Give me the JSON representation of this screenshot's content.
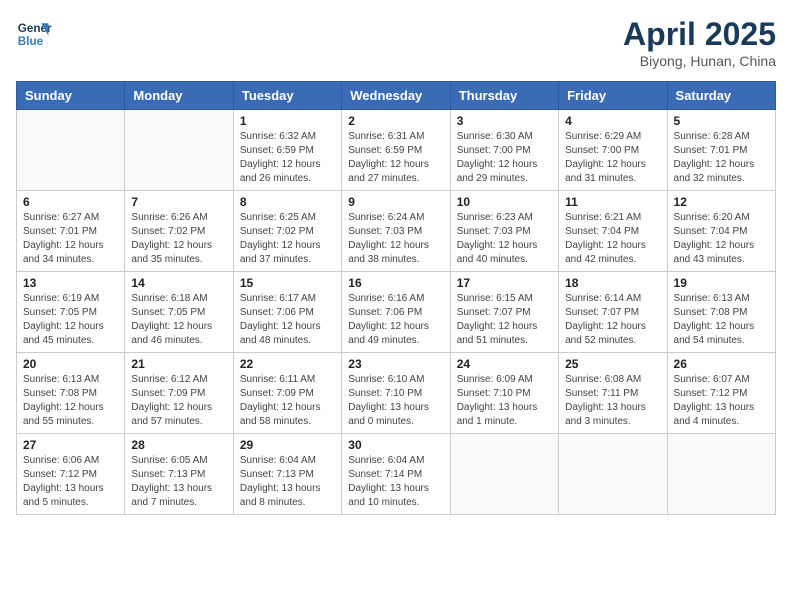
{
  "header": {
    "logo_line1": "General",
    "logo_line2": "Blue",
    "title": "April 2025",
    "location": "Biyong, Hunan, China"
  },
  "weekdays": [
    "Sunday",
    "Monday",
    "Tuesday",
    "Wednesday",
    "Thursday",
    "Friday",
    "Saturday"
  ],
  "weeks": [
    [
      {
        "day": "",
        "info": ""
      },
      {
        "day": "",
        "info": ""
      },
      {
        "day": "1",
        "info": "Sunrise: 6:32 AM\nSunset: 6:59 PM\nDaylight: 12 hours and 26 minutes."
      },
      {
        "day": "2",
        "info": "Sunrise: 6:31 AM\nSunset: 6:59 PM\nDaylight: 12 hours and 27 minutes."
      },
      {
        "day": "3",
        "info": "Sunrise: 6:30 AM\nSunset: 7:00 PM\nDaylight: 12 hours and 29 minutes."
      },
      {
        "day": "4",
        "info": "Sunrise: 6:29 AM\nSunset: 7:00 PM\nDaylight: 12 hours and 31 minutes."
      },
      {
        "day": "5",
        "info": "Sunrise: 6:28 AM\nSunset: 7:01 PM\nDaylight: 12 hours and 32 minutes."
      }
    ],
    [
      {
        "day": "6",
        "info": "Sunrise: 6:27 AM\nSunset: 7:01 PM\nDaylight: 12 hours and 34 minutes."
      },
      {
        "day": "7",
        "info": "Sunrise: 6:26 AM\nSunset: 7:02 PM\nDaylight: 12 hours and 35 minutes."
      },
      {
        "day": "8",
        "info": "Sunrise: 6:25 AM\nSunset: 7:02 PM\nDaylight: 12 hours and 37 minutes."
      },
      {
        "day": "9",
        "info": "Sunrise: 6:24 AM\nSunset: 7:03 PM\nDaylight: 12 hours and 38 minutes."
      },
      {
        "day": "10",
        "info": "Sunrise: 6:23 AM\nSunset: 7:03 PM\nDaylight: 12 hours and 40 minutes."
      },
      {
        "day": "11",
        "info": "Sunrise: 6:21 AM\nSunset: 7:04 PM\nDaylight: 12 hours and 42 minutes."
      },
      {
        "day": "12",
        "info": "Sunrise: 6:20 AM\nSunset: 7:04 PM\nDaylight: 12 hours and 43 minutes."
      }
    ],
    [
      {
        "day": "13",
        "info": "Sunrise: 6:19 AM\nSunset: 7:05 PM\nDaylight: 12 hours and 45 minutes."
      },
      {
        "day": "14",
        "info": "Sunrise: 6:18 AM\nSunset: 7:05 PM\nDaylight: 12 hours and 46 minutes."
      },
      {
        "day": "15",
        "info": "Sunrise: 6:17 AM\nSunset: 7:06 PM\nDaylight: 12 hours and 48 minutes."
      },
      {
        "day": "16",
        "info": "Sunrise: 6:16 AM\nSunset: 7:06 PM\nDaylight: 12 hours and 49 minutes."
      },
      {
        "day": "17",
        "info": "Sunrise: 6:15 AM\nSunset: 7:07 PM\nDaylight: 12 hours and 51 minutes."
      },
      {
        "day": "18",
        "info": "Sunrise: 6:14 AM\nSunset: 7:07 PM\nDaylight: 12 hours and 52 minutes."
      },
      {
        "day": "19",
        "info": "Sunrise: 6:13 AM\nSunset: 7:08 PM\nDaylight: 12 hours and 54 minutes."
      }
    ],
    [
      {
        "day": "20",
        "info": "Sunrise: 6:13 AM\nSunset: 7:08 PM\nDaylight: 12 hours and 55 minutes."
      },
      {
        "day": "21",
        "info": "Sunrise: 6:12 AM\nSunset: 7:09 PM\nDaylight: 12 hours and 57 minutes."
      },
      {
        "day": "22",
        "info": "Sunrise: 6:11 AM\nSunset: 7:09 PM\nDaylight: 12 hours and 58 minutes."
      },
      {
        "day": "23",
        "info": "Sunrise: 6:10 AM\nSunset: 7:10 PM\nDaylight: 13 hours and 0 minutes."
      },
      {
        "day": "24",
        "info": "Sunrise: 6:09 AM\nSunset: 7:10 PM\nDaylight: 13 hours and 1 minute."
      },
      {
        "day": "25",
        "info": "Sunrise: 6:08 AM\nSunset: 7:11 PM\nDaylight: 13 hours and 3 minutes."
      },
      {
        "day": "26",
        "info": "Sunrise: 6:07 AM\nSunset: 7:12 PM\nDaylight: 13 hours and 4 minutes."
      }
    ],
    [
      {
        "day": "27",
        "info": "Sunrise: 6:06 AM\nSunset: 7:12 PM\nDaylight: 13 hours and 5 minutes."
      },
      {
        "day": "28",
        "info": "Sunrise: 6:05 AM\nSunset: 7:13 PM\nDaylight: 13 hours and 7 minutes."
      },
      {
        "day": "29",
        "info": "Sunrise: 6:04 AM\nSunset: 7:13 PM\nDaylight: 13 hours and 8 minutes."
      },
      {
        "day": "30",
        "info": "Sunrise: 6:04 AM\nSunset: 7:14 PM\nDaylight: 13 hours and 10 minutes."
      },
      {
        "day": "",
        "info": ""
      },
      {
        "day": "",
        "info": ""
      },
      {
        "day": "",
        "info": ""
      }
    ]
  ]
}
